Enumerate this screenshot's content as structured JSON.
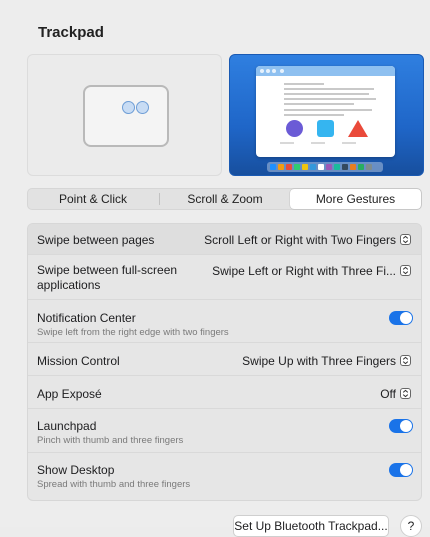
{
  "title": "Trackpad",
  "tabs": [
    {
      "label": "Point & Click",
      "active": false
    },
    {
      "label": "Scroll & Zoom",
      "active": false
    },
    {
      "label": "More Gestures",
      "active": true
    }
  ],
  "settings": [
    {
      "title": "Swipe between pages",
      "subtitle": "",
      "control": "popup",
      "value": "Scroll Left or Right with Two Fingers"
    },
    {
      "title": "Swipe between full-screen applications",
      "subtitle": "",
      "control": "popup",
      "value": "Swipe Left or Right with Three Fi..."
    },
    {
      "title": "Notification Center",
      "subtitle": "Swipe left from the right edge with two fingers",
      "control": "toggle",
      "value": true
    },
    {
      "title": "Mission Control",
      "subtitle": "",
      "control": "popup",
      "value": "Swipe Up with Three Fingers"
    },
    {
      "title": "App Exposé",
      "subtitle": "",
      "control": "popup",
      "value": "Off"
    },
    {
      "title": "Launchpad",
      "subtitle": "Pinch with thumb and three fingers",
      "control": "toggle",
      "value": true
    },
    {
      "title": "Show Desktop",
      "subtitle": "Spread with thumb and three fingers",
      "control": "toggle",
      "value": true
    }
  ],
  "footer": {
    "setup_button": "Set Up Bluetooth Trackpad...",
    "help_button": "?"
  },
  "colors": {
    "accent": "#1a73e8",
    "window_bg": "#ededed",
    "preview_blue": "#2f7fe0"
  },
  "icons": {
    "stepper": "chevron-up-down-icon",
    "preview_shapes": [
      "circle",
      "square",
      "triangle"
    ]
  }
}
